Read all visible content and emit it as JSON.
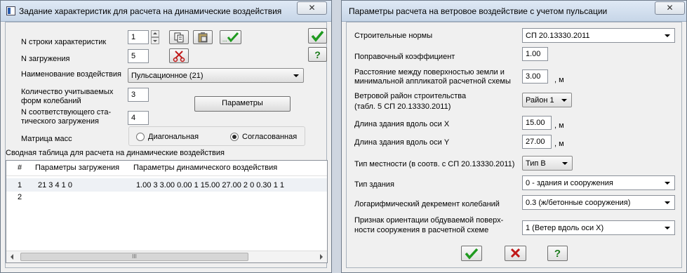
{
  "left_window": {
    "title": "Задание характеристик для расчета на динамические воздействия",
    "close_glyph": "✕",
    "row_number_label": "N строки характеристик",
    "row_number_value": "1",
    "load_number_label": "N загружения",
    "load_number_value": "5",
    "impact_name_label": "Наименование воздействия",
    "impact_name_value": "Пульсационное (21)",
    "modes_count_label_1": "Количество учитываемых",
    "modes_count_label_2": "форм колебаний",
    "modes_count_value": "3",
    "static_load_label_1": "N соответствующего ста-",
    "static_load_label_2": "тического загружения",
    "static_load_value": "4",
    "params_button": "Параметры",
    "mass_matrix_label": "Матрица масс",
    "mass_options": [
      "Диагональная",
      "Согласованная"
    ],
    "mass_selected": "Согласованная",
    "help_glyph": "?",
    "summary_title": "Сводная таблица для расчета на динамические воздействия",
    "table_headers": [
      "#",
      "Параметры загружения",
      "Параметры динамического воздействия"
    ],
    "table_rows": [
      {
        "n": "1",
        "load_params": "21  3  4  1 0",
        "dyn_params": "1.00 3 3.00 0.00 1 15.00 27.00 2 0 0.30 1 1"
      },
      {
        "n": "2",
        "load_params": "",
        "dyn_params": ""
      }
    ],
    "scroll_thumb": "III"
  },
  "right_window": {
    "title": "Параметры расчета на ветровое воздействие с учетом пульсации",
    "close_glyph": "✕",
    "norms_label": "Строительные нормы",
    "norms_value": "СП 20.13330.2011",
    "correction_label": "Поправочный коэффициент",
    "correction_value": "1.00",
    "distance_label_1": "Расстояние между поверхностью земли и",
    "distance_label_2": "минимальной аппликатой расчетной схемы",
    "distance_value": "3.00",
    "unit_m": ", м",
    "wind_region_label_1": "Ветровой район строительства",
    "wind_region_label_2": "(табл. 5  СП 20.13330.2011)",
    "wind_region_value": "Район 1",
    "length_x_label": "Длина здания вдоль оси X",
    "length_x_value": "15.00",
    "length_y_label": "Длина здания вдоль оси Y",
    "length_y_value": "27.00",
    "terrain_label": "Тип местности (в соотв. с СП 20.13330.2011)",
    "terrain_value": "Тип В",
    "building_type_label": "Тип здания",
    "building_type_value": "0 - здания и сооружения",
    "decrement_label": "Логарифмический декремент колебаний",
    "decrement_value": "0.3 (ж/бетонные сооружения)",
    "orientation_label_1": "Признак ориентации обдуваемой поверх-",
    "orientation_label_2": "ности сооружения в расчетной схеме",
    "orientation_value": "1 (Ветер вдоль оси X)",
    "help_glyph": "?"
  },
  "colors": {
    "ok_green": "#1f9a1f",
    "cancel_red": "#c01818",
    "help_green": "#1a7a1a"
  }
}
